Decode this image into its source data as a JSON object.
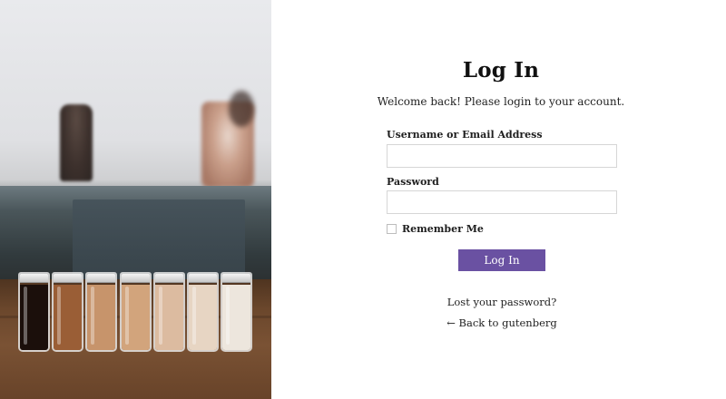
{
  "login": {
    "title": "Log In",
    "subtitle": "Welcome back! Please login to your account.",
    "username_label": "Username or Email Address",
    "username_value": "",
    "password_label": "Password",
    "password_value": "",
    "remember_label": "Remember Me",
    "remember_checked": false,
    "submit_label": "Log In",
    "lost_password_link": "Lost your password?",
    "back_link": "← Back to gutenberg"
  },
  "colors": {
    "accent": "#6a51a2",
    "background": "#ffffff",
    "input_border": "#d6d6d6"
  },
  "photo": {
    "subject": "coffee-jars-photo",
    "jars": [
      {
        "color": "#1b0f0b"
      },
      {
        "color": "#9a5e36"
      },
      {
        "color": "#c7946b"
      },
      {
        "color": "#d2a47c"
      },
      {
        "color": "#dcbba0"
      },
      {
        "color": "#e7d5c3"
      },
      {
        "color": "#ede6dd"
      }
    ]
  }
}
